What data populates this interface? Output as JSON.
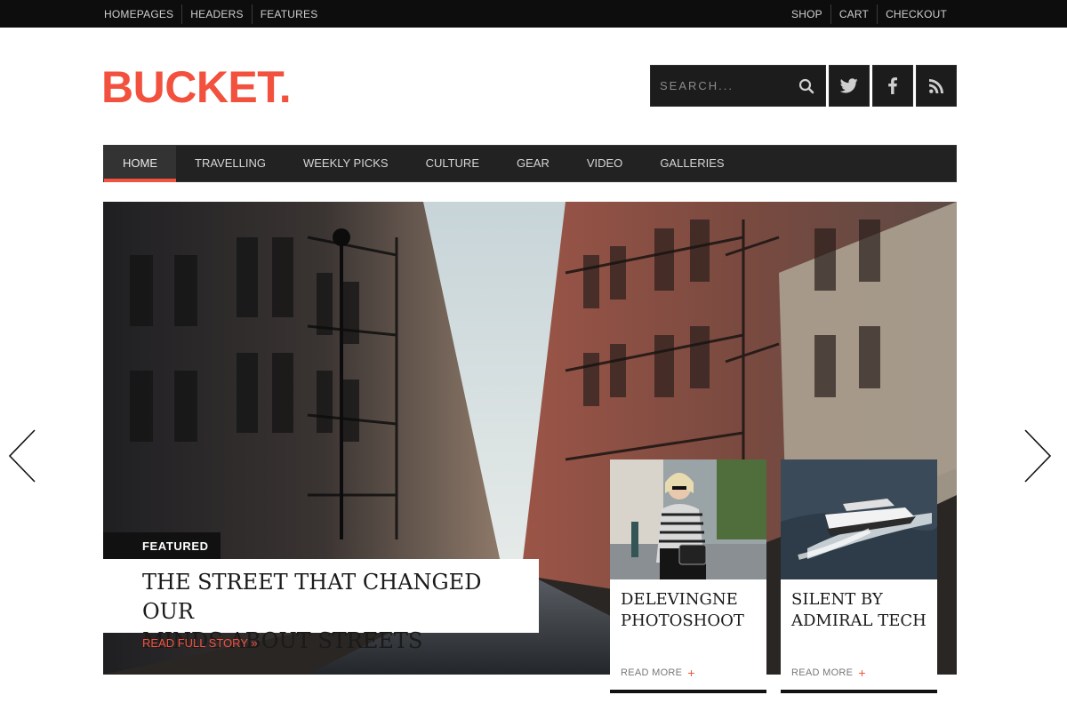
{
  "topbar": {
    "left_links": [
      "HOMEPAGES",
      "HEADERS",
      "FEATURES"
    ],
    "right_links": [
      "SHOP",
      "CART",
      "CHECKOUT"
    ]
  },
  "logo": {
    "text": "BUCKET",
    "dot": "."
  },
  "search": {
    "placeholder": "SEARCH..."
  },
  "social": [
    "twitter-icon",
    "facebook-icon",
    "rss-icon"
  ],
  "nav": {
    "items": [
      "HOME",
      "TRAVELLING",
      "WEEKLY PICKS",
      "CULTURE",
      "GEAR",
      "VIDEO",
      "GALLERIES"
    ],
    "active": "HOME"
  },
  "hero": {
    "tag": "FEATURED",
    "headline_line1": "THE STREET THAT CHANGED OUR",
    "headline_line2": "MINDS ABOUT STREETS",
    "cta": "READ FULL STORY »"
  },
  "cards": [
    {
      "title_line1": "DELEVINGNE",
      "title_line2": "PHOTOSHOOT",
      "more": "READ MORE",
      "plus": "+"
    },
    {
      "title_line1": "SILENT BY",
      "title_line2": "ADMIRAL TECH",
      "more": "READ MORE",
      "plus": "+"
    }
  ],
  "colors": {
    "accent": "#f2513e",
    "topbar": "#0d0d0d",
    "nav": "#222222"
  }
}
